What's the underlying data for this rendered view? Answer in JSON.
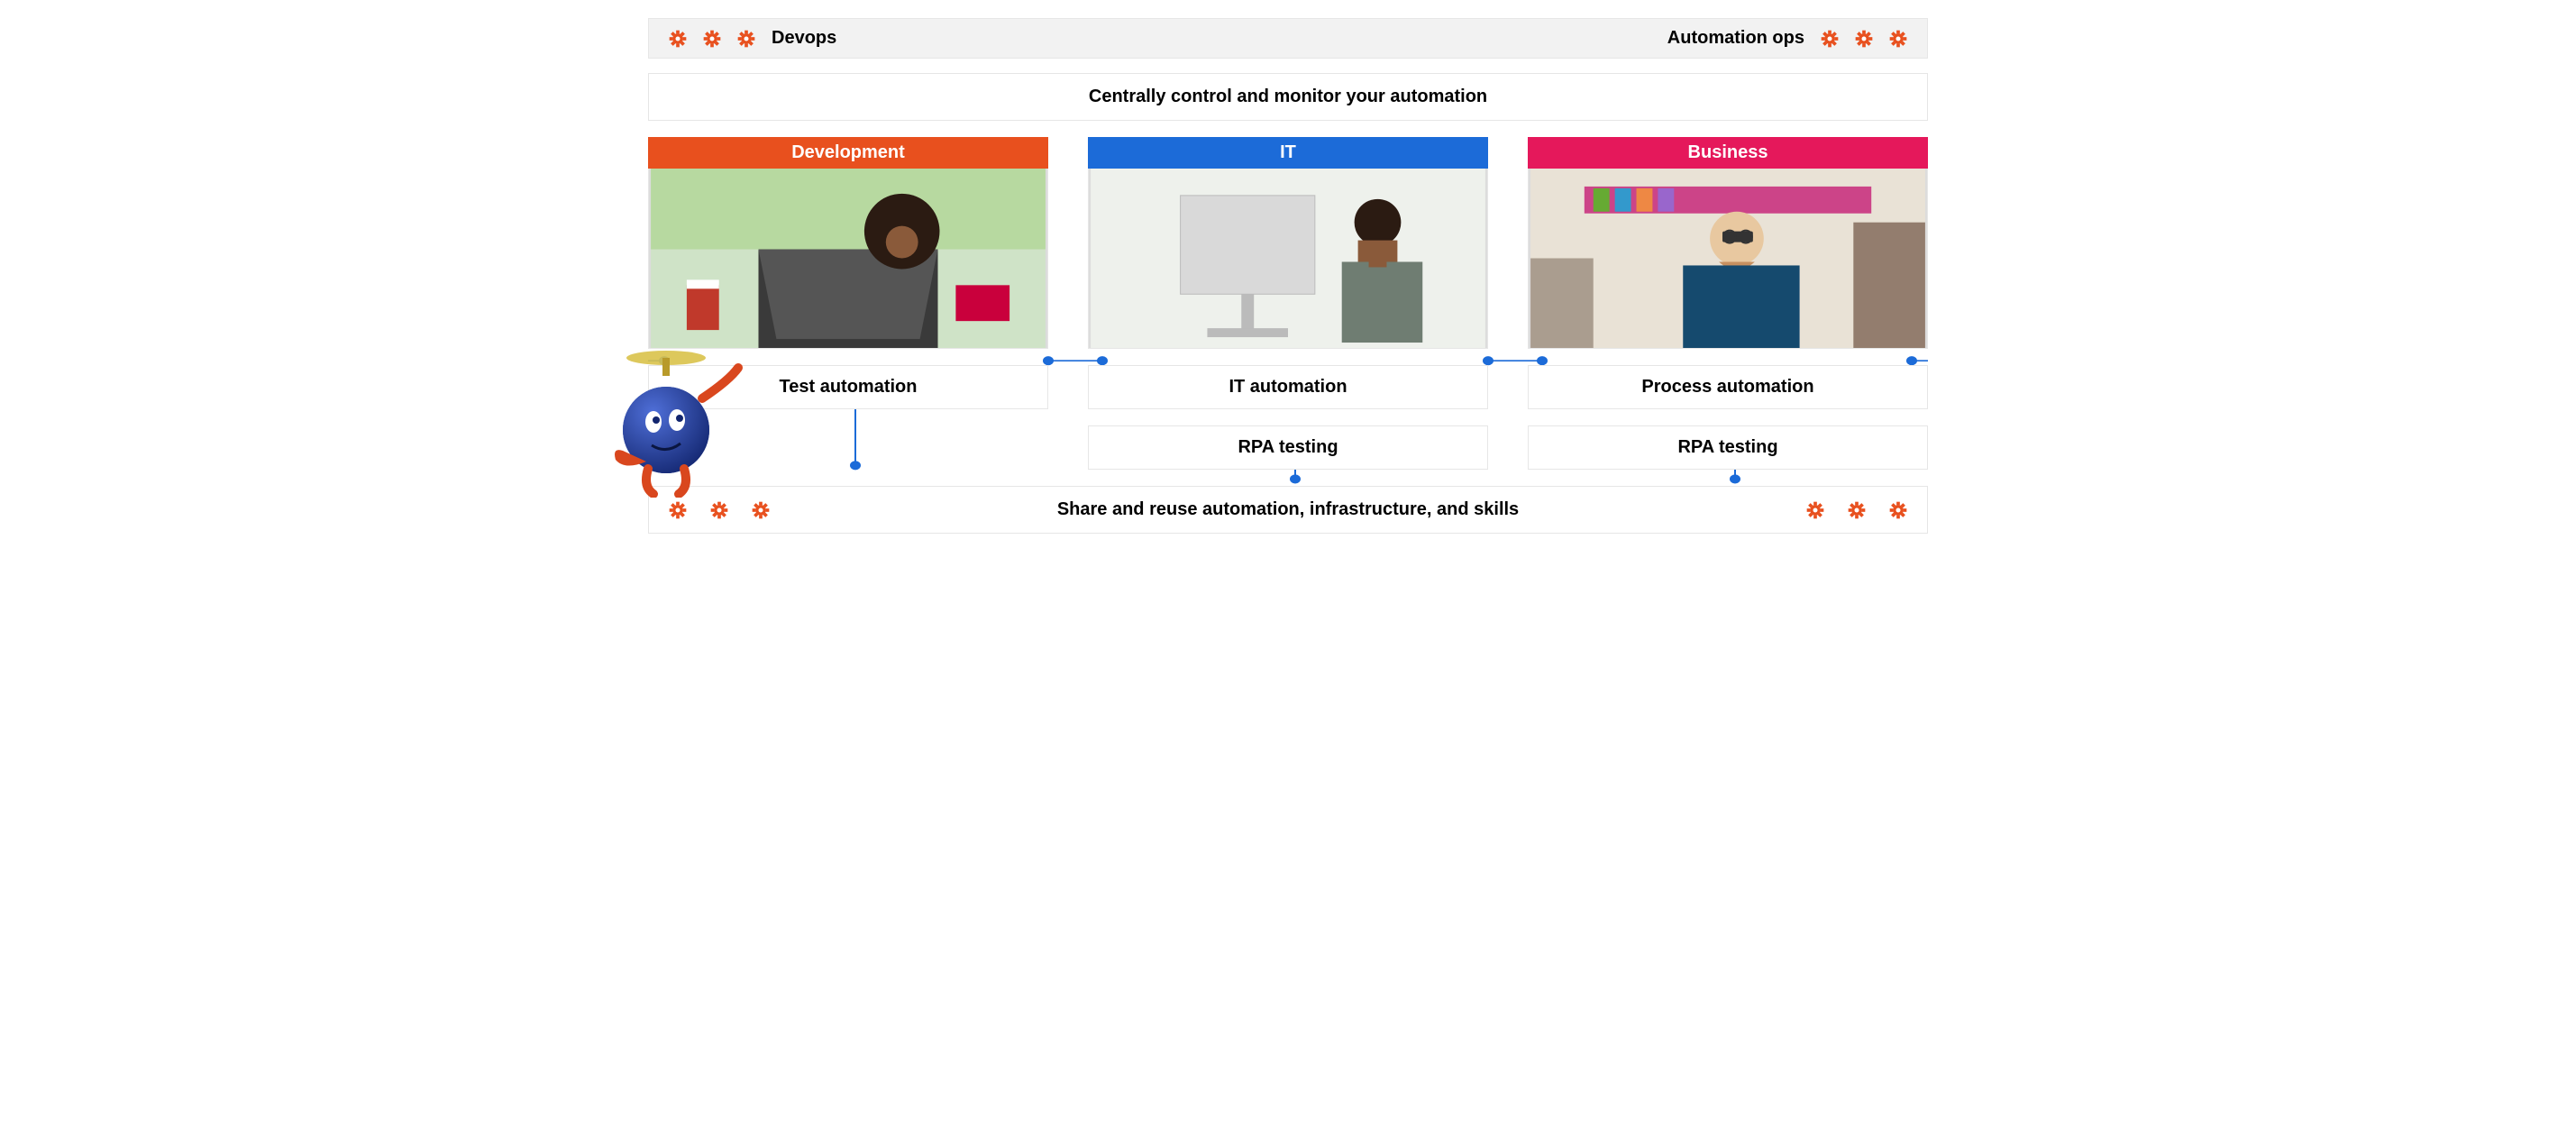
{
  "header": {
    "left_label": "Devops",
    "right_label": "Automation ops"
  },
  "subtitle": "Centrally control and monitor your automation",
  "columns": [
    {
      "title": "Development",
      "color": "#e8501e",
      "box1": "Test automation",
      "box2": null
    },
    {
      "title": "IT",
      "color": "#1c6bd8",
      "box1": "IT automation",
      "box2": "RPA testing"
    },
    {
      "title": "Business",
      "color": "#e5185b",
      "box1": "Process automation",
      "box2": "RPA testing"
    }
  ],
  "footer": "Share and reuse automation, infrastructure, and skills",
  "icons": {
    "gear_color": "#e8501e",
    "connector_color": "#1c6bd8"
  }
}
